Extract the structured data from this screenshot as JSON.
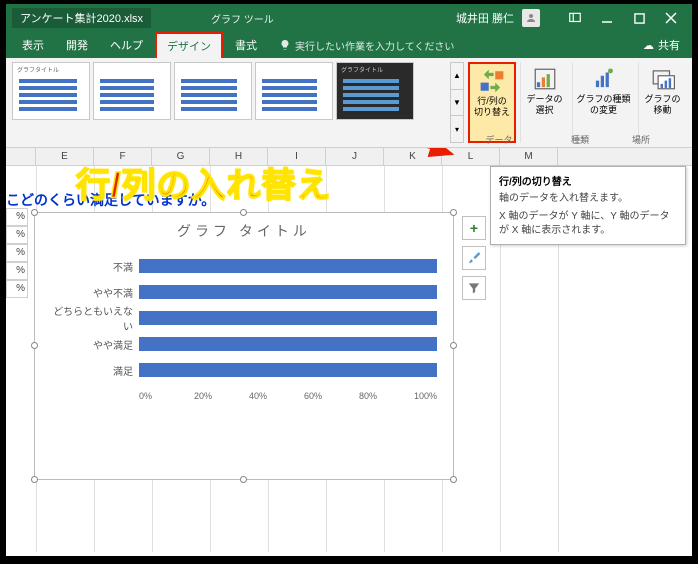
{
  "title": {
    "filename": "アンケート集計2020.xlsx",
    "tooltab": "グラフ ツール",
    "username": "城井田 勝仁"
  },
  "tabs": {
    "t0": "表示",
    "t1": "開発",
    "t2": "ヘルプ",
    "t3": "デザイン",
    "t4": "書式"
  },
  "tell": "実行したい作業を入力してください",
  "share": "共有",
  "ribbon": {
    "switch": "行/列の\n切り替え",
    "select": "データの\n選択",
    "type": "グラフの種類\nの変更",
    "move": "グラフの\n移動",
    "grp_data": "データ",
    "grp_type": "種類",
    "grp_loc": "場所"
  },
  "cols": [
    "E",
    "F",
    "G",
    "H",
    "I",
    "J",
    "K",
    "L",
    "M"
  ],
  "question": "こどのくらい満足していますか。",
  "pct": [
    "%",
    "%",
    "%",
    "%",
    "%"
  ],
  "chart_data": {
    "type": "bar",
    "title": "グラフ タイトル",
    "categories": [
      "不満",
      "やや不満",
      "どちらともいえない",
      "やや満足",
      "満足"
    ],
    "values": [
      100,
      100,
      100,
      100,
      100
    ],
    "xlabel": "",
    "ylabel": "",
    "ylim": [
      0,
      100
    ],
    "ticks": [
      "0%",
      "20%",
      "40%",
      "60%",
      "80%",
      "100%"
    ]
  },
  "tooltip": {
    "title": "行/列の切り替え",
    "line1": "軸のデータを入れ替えます。",
    "line2": "X 軸のデータが Y 軸に、Y 軸のデータが X 軸に表示されます。"
  },
  "annot": "行/列の入れ替え"
}
